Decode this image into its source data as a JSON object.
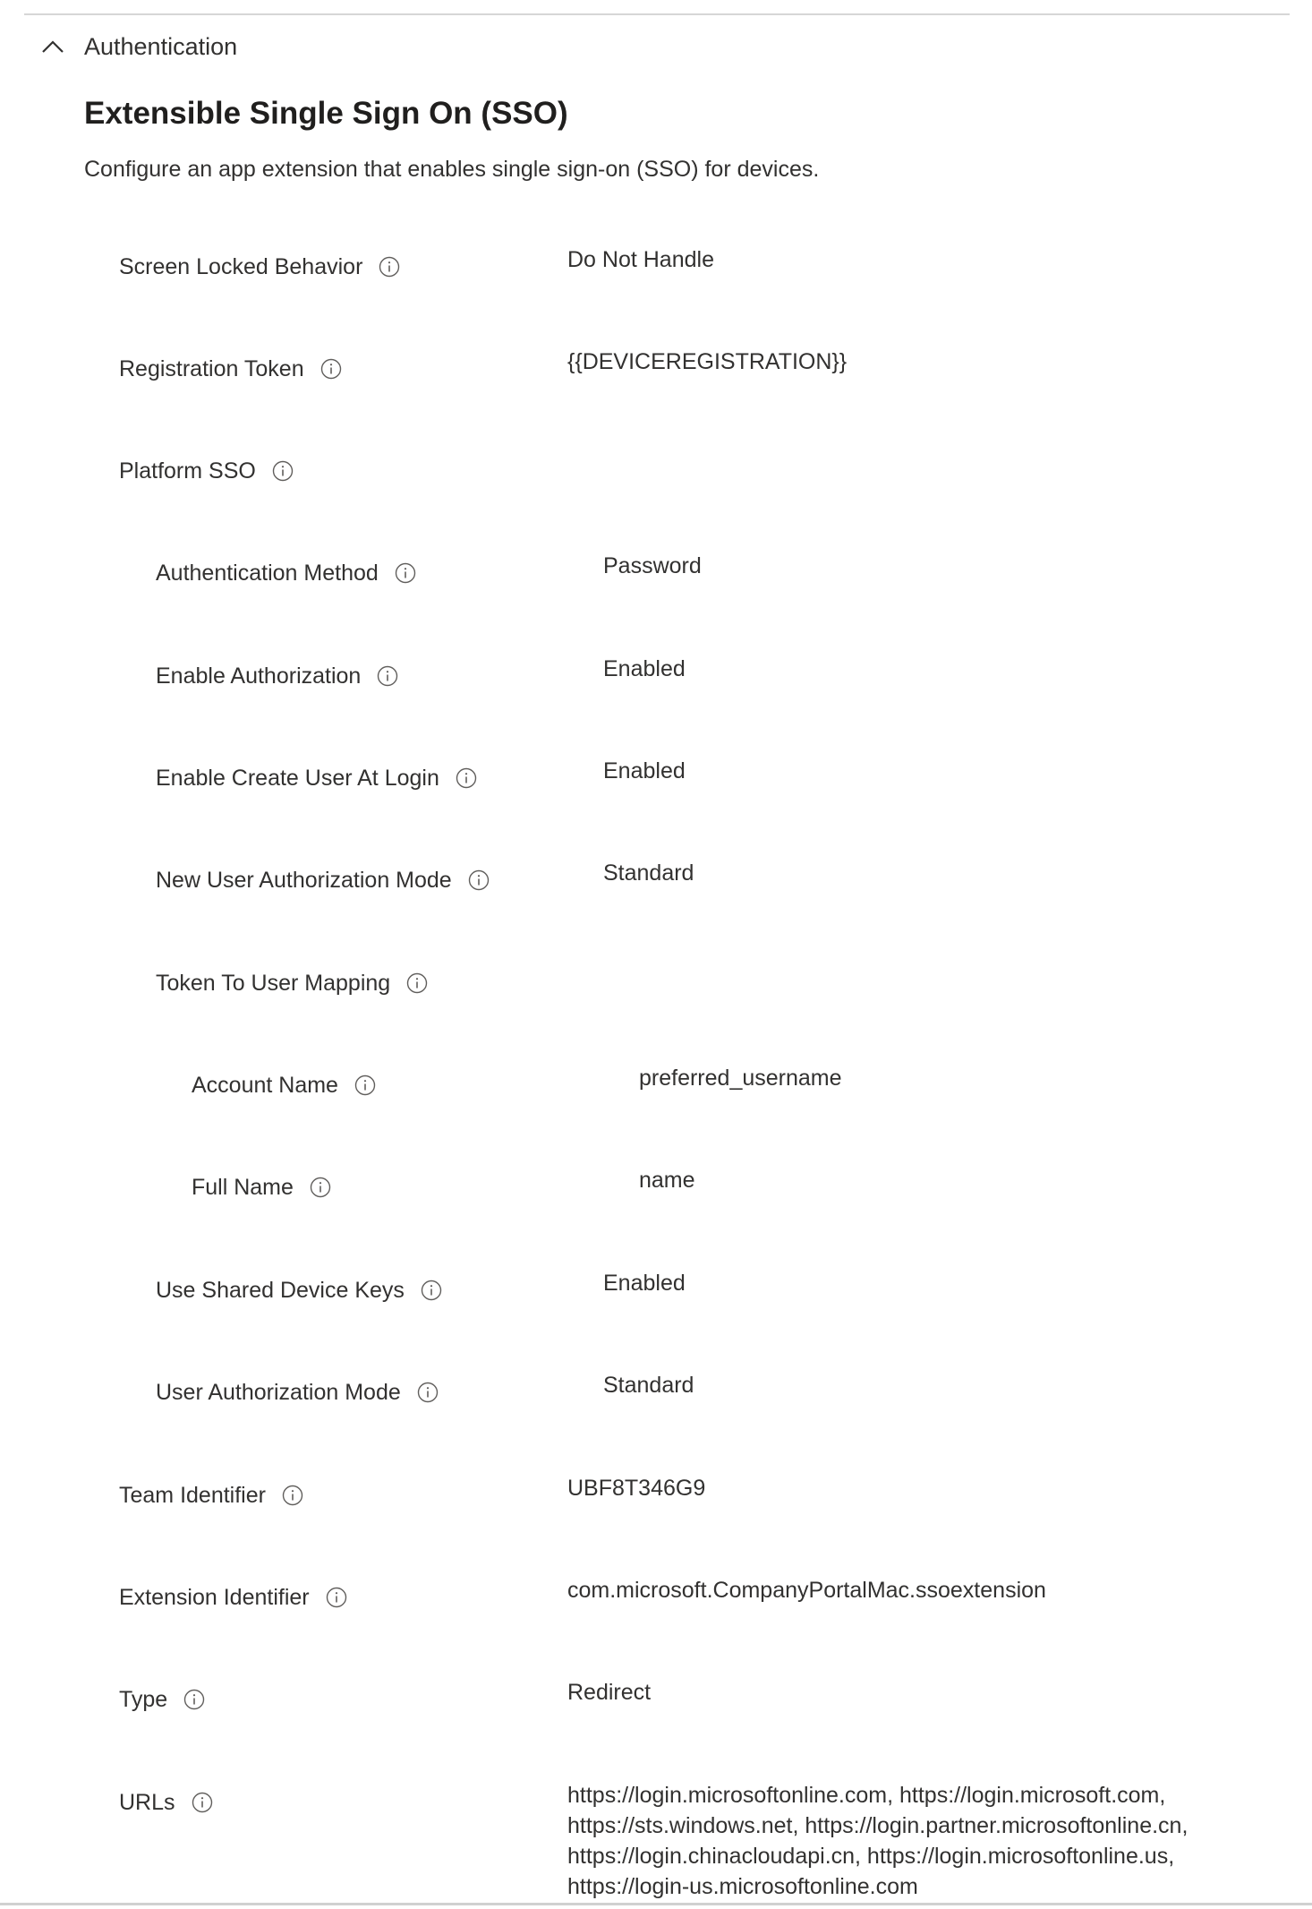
{
  "section": {
    "label": "Authentication",
    "expanded": true
  },
  "page": {
    "title": "Extensible Single Sign On (SSO)",
    "description": "Configure an app extension that enables single sign-on (SSO) for devices."
  },
  "settings": [
    {
      "label": "Screen Locked Behavior",
      "value": "Do Not Handle",
      "level": 1
    },
    {
      "label": "Registration Token",
      "value": "{{DEVICEREGISTRATION}}",
      "level": 1
    },
    {
      "label": "Platform SSO",
      "value": "",
      "level": 1
    },
    {
      "label": "Authentication Method",
      "value": "Password",
      "level": 2
    },
    {
      "label": "Enable Authorization",
      "value": "Enabled",
      "level": 2
    },
    {
      "label": "Enable Create User At Login",
      "value": "Enabled",
      "level": 2
    },
    {
      "label": "New User Authorization Mode",
      "value": "Standard",
      "level": 2
    },
    {
      "label": "Token To User Mapping",
      "value": "",
      "level": 2
    },
    {
      "label": "Account Name",
      "value": "preferred_username",
      "level": 3
    },
    {
      "label": "Full Name",
      "value": "name",
      "level": 3
    },
    {
      "label": "Use Shared Device Keys",
      "value": "Enabled",
      "level": 2
    },
    {
      "label": "User Authorization Mode",
      "value": "Standard",
      "level": 2
    },
    {
      "label": "Team Identifier",
      "value": "UBF8T346G9",
      "level": 1
    },
    {
      "label": "Extension Identifier",
      "value": "com.microsoft.CompanyPortalMac.ssoextension",
      "level": 1
    },
    {
      "label": "Type",
      "value": "Redirect",
      "level": 1
    },
    {
      "label": "URLs",
      "value": "https://login.microsoftonline.com, https://login.microsoft.com, https://sts.windows.net, https://login.partner.microsoftonline.cn, https://login.chinacloudapi.cn, https://login.microsoftonline.us, https://login-us.microsoftonline.com",
      "level": 1
    }
  ],
  "colors": {
    "text": "#323130",
    "title": "#201f1e",
    "icon": "#605e5c",
    "divider": "#d6d6d6"
  },
  "icons": {
    "toggle": "chevron-up-icon",
    "info": "info-icon"
  }
}
